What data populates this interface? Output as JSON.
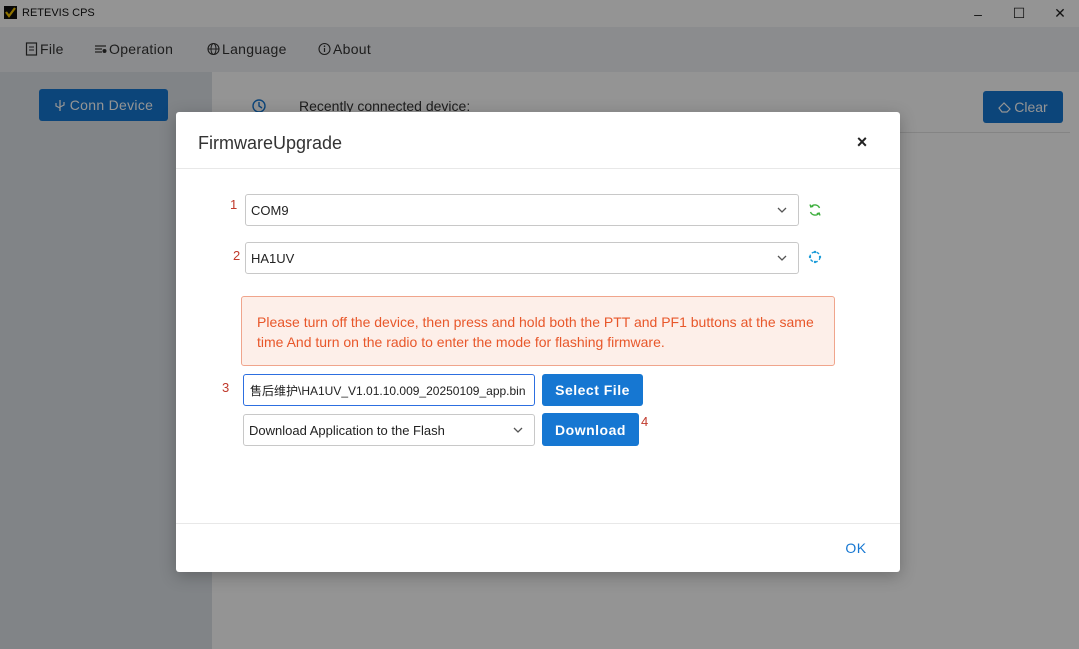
{
  "window": {
    "title": "RETEVIS CPS",
    "controls": {
      "minimize": "–",
      "maximize": "☐",
      "close": "✕"
    }
  },
  "menu": {
    "items": [
      {
        "label": "File",
        "icon": "file-icon"
      },
      {
        "label": "Operation",
        "icon": "operation-icon"
      },
      {
        "label": "Language",
        "icon": "globe-icon"
      },
      {
        "label": "About",
        "icon": "info-icon"
      }
    ]
  },
  "sidebar": {
    "conn_label": "Conn Device",
    "conn_icon": "usb-icon"
  },
  "main": {
    "recent_label": "Recently connected device:",
    "clear_label": "Clear",
    "clear_icon": "eraser-icon"
  },
  "dialog": {
    "title": "FirmwareUpgrade",
    "close": "×",
    "steps": [
      "1",
      "2",
      "3",
      "4"
    ],
    "port_select": {
      "value": "COM9",
      "icon": "refresh-icon"
    },
    "model_select": {
      "value": "HA1UV",
      "icon": "spinner-icon"
    },
    "alert_text": "Please turn off the device, then press and hold both the PTT and PF1 buttons at the same time And turn on the radio to enter the mode for flashing firmware.",
    "file_path": "售后维护\\HA1UV_V1.01.10.009_20250109_app.bin",
    "select_file_label": "Select File",
    "mode_select": {
      "value": "Download Application to the Flash"
    },
    "download_label": "Download",
    "ok_label": "OK"
  },
  "colors": {
    "primary": "#1677d2",
    "alert_text": "#e8572a",
    "alert_bg": "#fdefe9",
    "step_number": "#c0392b",
    "refresh_icon": "#3cae3c"
  }
}
